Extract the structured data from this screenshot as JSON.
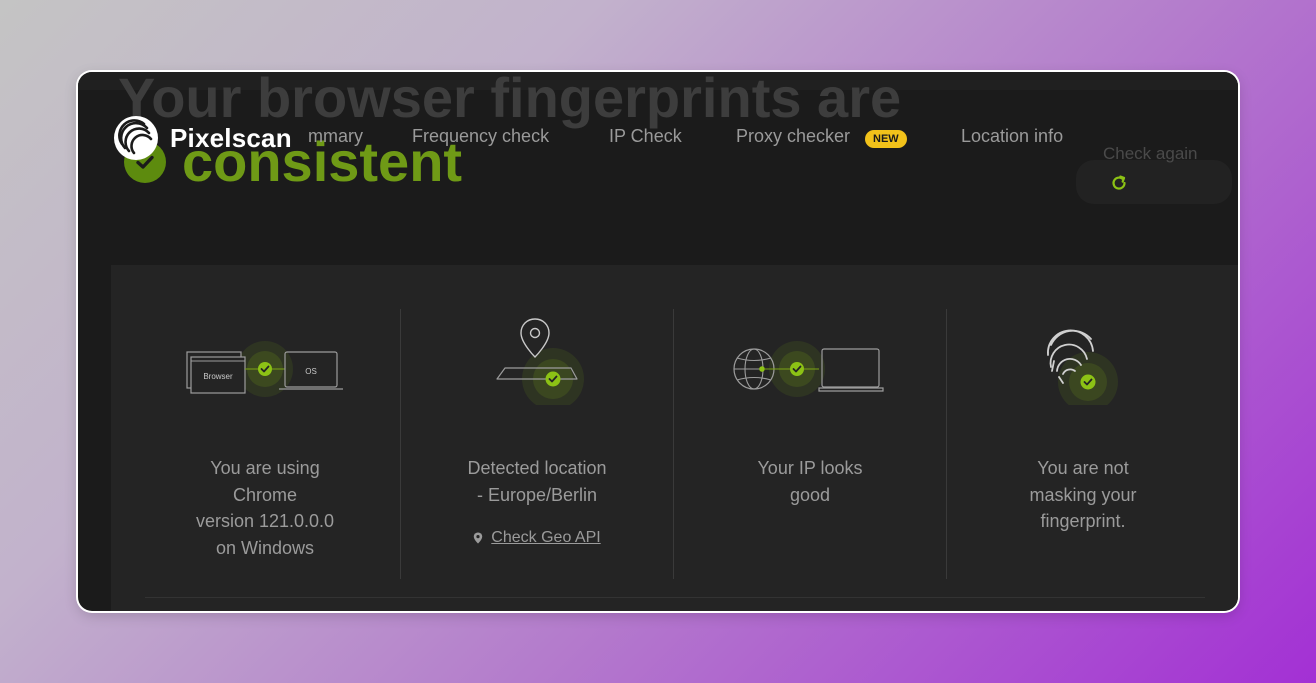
{
  "background_heading": {
    "title": "Your browser fingerprints are",
    "status": "consistent",
    "check_again": "Check again"
  },
  "nav": {
    "brand": "Pixelscan",
    "items": [
      "Summary",
      "Frequency check",
      "IP Check",
      "Proxy checker",
      "Location info"
    ],
    "visible_labels": [
      "mmary",
      "Frequency check",
      "IP Check",
      "Proxy checker",
      "Location info"
    ],
    "badge": "NEW"
  },
  "cards": [
    {
      "text_lines": [
        "You are using",
        "Chrome",
        "version 121.0.0.0",
        "on Windows"
      ],
      "labels": {
        "left": "Browser",
        "right": "OS"
      }
    },
    {
      "text_lines": [
        "Detected location",
        "- Europe/Berlin"
      ],
      "link": "Check Geo API"
    },
    {
      "text_lines": [
        "Your IP looks",
        "good"
      ]
    },
    {
      "text_lines": [
        "You are not",
        "masking your",
        "fingerprint."
      ]
    }
  ],
  "icons": [
    "check-circle-icon",
    "refresh-icon",
    "pixelscan-logo-icon",
    "location-pin-icon",
    "globe-icon",
    "laptop-icon",
    "fingerprint-icon"
  ],
  "colors": {
    "accent_green": "#8cc215",
    "badge_yellow": "#f2c21a",
    "panel_bg": "#242424",
    "frame_bg": "#1b1b1b"
  }
}
